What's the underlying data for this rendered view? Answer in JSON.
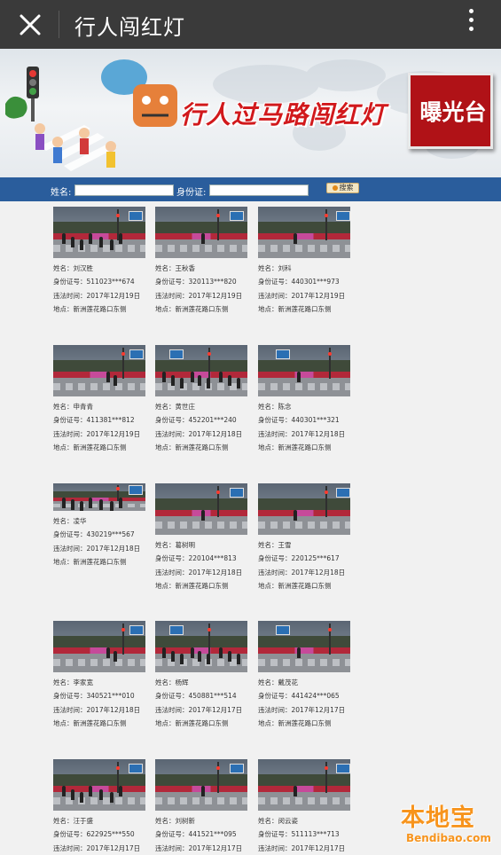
{
  "titlebar": {
    "title": "行人闯红灯",
    "close_icon": "close-icon",
    "more_icon": "more-vertical-icon"
  },
  "banner": {
    "title": "行人过马路闯红灯",
    "badge": "曝光台"
  },
  "search": {
    "name_label": "姓名:",
    "id_label": "身份证:",
    "button_label": "搜索",
    "name_value": "",
    "id_value": ""
  },
  "records": [
    {
      "name": "姓名：刘汉胜",
      "id": "身份证号：511023***674",
      "time": "违法时间：2017年12月19日",
      "place": "地点：新洲莲花路口东侧"
    },
    {
      "name": "姓名：王秋香",
      "id": "身份证号：320113***820",
      "time": "违法时间：2017年12月19日",
      "place": "地点：新洲莲花路口东侧"
    },
    {
      "name": "姓名：刘科",
      "id": "身份证号：440301***973",
      "time": "违法时间：2017年12月19日",
      "place": "地点：新洲莲花路口东侧"
    },
    {
      "name": "姓名：申青青",
      "id": "身份证号：411381***812",
      "time": "违法时间：2017年12月19日",
      "place": "地点：新洲莲花路口东侧"
    },
    {
      "name": "姓名：黄世庄",
      "id": "身份证号：452201***240",
      "time": "违法时间：2017年12月18日",
      "place": "地点：新洲莲花路口东侧"
    },
    {
      "name": "姓名：陈念",
      "id": "身份证号：440301***321",
      "time": "违法时间：2017年12月18日",
      "place": "地点：新洲莲花路口东侧"
    },
    {
      "name": "姓名：凌华",
      "id": "身份证号：430219***567",
      "time": "违法时间：2017年12月18日",
      "place": "地点：新洲莲花路口东侧"
    },
    {
      "name": "姓名：葛树明",
      "id": "身份证号：220104***813",
      "time": "违法时间：2017年12月18日",
      "place": "地点：新洲莲花路口东侧"
    },
    {
      "name": "姓名：王雪",
      "id": "身份证号：220125***617",
      "time": "违法时间：2017年12月18日",
      "place": "地点：新洲莲花路口东侧"
    },
    {
      "name": "姓名：李家宽",
      "id": "身份证号：340521***010",
      "time": "违法时间：2017年12月18日",
      "place": "地点：新洲莲花路口东侧"
    },
    {
      "name": "姓名：杨辉",
      "id": "身份证号：450881***514",
      "time": "违法时间：2017年12月17日",
      "place": "地点：新洲莲花路口东侧"
    },
    {
      "name": "姓名：戴茂花",
      "id": "身份证号：441424***065",
      "time": "违法时间：2017年12月17日",
      "place": "地点：新洲莲花路口东侧"
    },
    {
      "name": "姓名：汪于盛",
      "id": "身份证号：622925***550",
      "time": "违法时间：2017年12月17日",
      "place": ""
    },
    {
      "name": "姓名：刘树新",
      "id": "身份证号：441521***095",
      "time": "违法时间：2017年12月17日",
      "place": ""
    },
    {
      "name": "姓名：闵云姿",
      "id": "身份证号：511113***713",
      "time": "违法时间：2017年12月17日",
      "place": ""
    }
  ],
  "watermark": {
    "main": "本地宝",
    "sub": "Bendibao.com"
  },
  "colors": {
    "titlebar": "#3a3a3a",
    "search_bar": "#2a5d9c",
    "banner_red": "#d1191c",
    "page_bg": "#f1f1f1"
  }
}
